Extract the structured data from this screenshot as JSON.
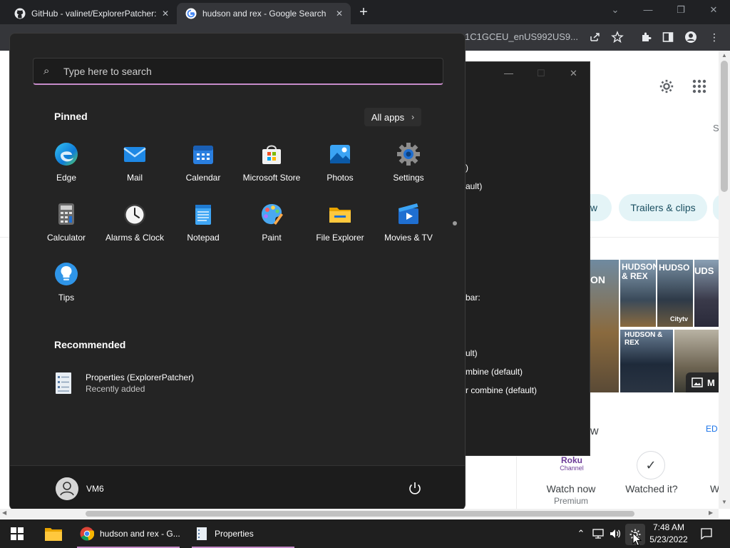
{
  "browser": {
    "tabs": [
      {
        "title": "GitHub - valinet/ExplorerPatcher:",
        "active": false
      },
      {
        "title": "hudson and rex - Google Search",
        "active": true
      }
    ],
    "new_tab_label": "+",
    "url_fragment": "1C1GCEU_enUS992US9..."
  },
  "google_page": {
    "chip_partial": "w",
    "chip_trailers": "Trailers & clips",
    "side_letter": "S",
    "ed_link": "ED",
    "section_partial": "w",
    "posters": [
      "ON",
      "HUDSON & REX",
      "HUDSO",
      "UDS",
      "HUDSON & REX"
    ],
    "citytv_label": "Citytv",
    "more_images_label": "M",
    "roku_label": "Roku",
    "roku_sub": "Channel",
    "watch_now": "Watch now",
    "premium": "Premium",
    "watched_it": "Watched it?",
    "edge_letter": "W"
  },
  "props_window": {
    "lines": [
      ")",
      "ault)",
      "bar:",
      "ult)",
      "mbine (default)",
      "r combine (default)"
    ]
  },
  "start_menu": {
    "search_placeholder": "Type here to search",
    "pinned_title": "Pinned",
    "all_apps_label": "All apps",
    "pinned_apps": [
      {
        "label": "Edge",
        "icon": "edge-icon"
      },
      {
        "label": "Mail",
        "icon": "mail-icon"
      },
      {
        "label": "Calendar",
        "icon": "calendar-icon"
      },
      {
        "label": "Microsoft Store",
        "icon": "store-icon"
      },
      {
        "label": "Photos",
        "icon": "photos-icon"
      },
      {
        "label": "Settings",
        "icon": "settings-icon"
      },
      {
        "label": "Calculator",
        "icon": "calculator-icon"
      },
      {
        "label": "Alarms & Clock",
        "icon": "clock-icon"
      },
      {
        "label": "Notepad",
        "icon": "notepad-icon"
      },
      {
        "label": "Paint",
        "icon": "paint-icon"
      },
      {
        "label": "File Explorer",
        "icon": "folder-icon"
      },
      {
        "label": "Movies & TV",
        "icon": "movies-icon"
      },
      {
        "label": "Tips",
        "icon": "tips-icon"
      }
    ],
    "recommended_title": "Recommended",
    "recommended": [
      {
        "name": "Properties (ExplorerPatcher)",
        "subtitle": "Recently added"
      }
    ],
    "user_name": "VM6"
  },
  "taskbar": {
    "chrome_label": "hudson and rex - G...",
    "properties_label": "Properties",
    "time": "7:48 AM",
    "date": "5/23/2022"
  },
  "colors": {
    "accent": "#c68bc9",
    "start_bg": "#242424",
    "taskbar_bg": "#1f1f1f",
    "chip_bg": "#e4f4f7"
  }
}
